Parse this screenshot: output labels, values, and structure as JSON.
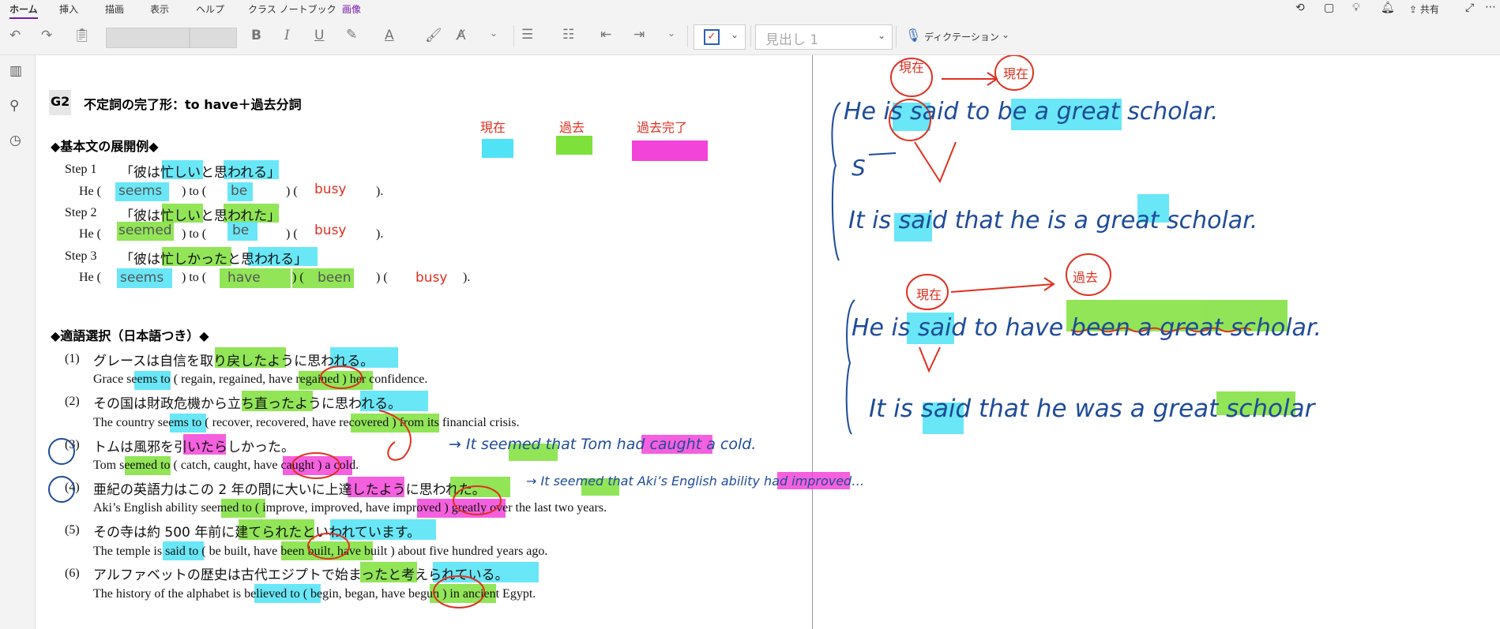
{
  "ribbon": {
    "tabs": [
      "ホーム",
      "挿入",
      "描画",
      "表示",
      "ヘルプ",
      "クラス ノートブック",
      "画像"
    ],
    "active_tab": "ホーム",
    "share_label": "共有",
    "heading_style": "見出し 1",
    "dictation_label": "ディクテーション"
  },
  "note": {
    "section_tag": "G2",
    "title": "不定詞の完了形：to have＋過去分詞",
    "legend": {
      "present": "現在",
      "past": "過去",
      "past_perfect": "過去完了"
    },
    "colors": {
      "present": "#4fe3f5",
      "past": "#7ee03a",
      "past_perfect": "#f244d8",
      "ink": "#1f4b99",
      "red_ink": "#e03020"
    },
    "section1_heading": "◆基本文の展開例◆",
    "step1_label": "Step 1",
    "step1_jp": "「彼は忙しいと思われる」",
    "step1_he": "He (",
    "step1_a": "seems",
    "step1_to": ") to (",
    "step1_b": "be",
    "step1_paren": ") (",
    "step1_c": "busy",
    "step1_end": ").",
    "step2_label": "Step 2",
    "step2_jp": "「彼は忙しいと思われた」",
    "step2_he": "He (",
    "step2_a": "seemed",
    "step2_to": ") to (",
    "step2_b": "be",
    "step2_paren": ") (",
    "step2_c": "busy",
    "step2_end": ").",
    "step3_label": "Step 3",
    "step3_jp": "「彼は忙しかったと思われる」",
    "step3_he": "He (",
    "step3_a": "seems",
    "step3_to": ") to (",
    "step3_b": "have",
    "step3_p1": ") (",
    "step3_c": "been",
    "step3_p2": ") (",
    "step3_d": "busy",
    "step3_end": ").",
    "section2_heading": "◆適語選択（日本語つき）◆",
    "q1_num": "(1)",
    "q1_jp": "グレースは自信を取り戻したように思われる。",
    "q1_en": "Grace seems to ( regain, regained, have regained ) her confidence.",
    "q2_num": "(2)",
    "q2_jp": "その国は財政危機から立ち直ったように思われる。",
    "q2_en": "The country seems to ( recover, recovered, have recovered ) from its financial crisis.",
    "q3_num": "(3)",
    "q3_jp": "トムは風邪を引いたらしかった。",
    "q3_en": "Tom seemed to ( catch, caught, have caught ) a cold.",
    "q4_num": "(4)",
    "q4_jp": "亜紀の英語力はこの 2 年の間に大いに上達したように思われた。",
    "q4_en": "Aki’s English ability seemed to ( improve, improved, have improved ) greatly over the last two years.",
    "q5_num": "(5)",
    "q5_jp": "その寺は約 500 年前に建てられたといわれています。",
    "q5_en": "The temple is said to ( be built, have been built, have built ) about five hundred years ago.",
    "q6_num": "(6)",
    "q6_jp": "アルファベットの歴史は古代エジプトで始まったと考えられている。",
    "q6_en": "The history of the alphabet is believed to ( begin, began, have begun ) in ancient Egypt."
  },
  "handwriting": {
    "note3": "→ It seemed that Tom had caught a cold.",
    "note4": "→ It seemed that Aki’s English ability had improved…",
    "genzai_1": "現在",
    "genzai_2": "現在",
    "genzai_3": "現在",
    "kako": "過去",
    "s1": "He is said to be a great scholar.",
    "s_label": "S",
    "s2": "It is said that he is a great scholar.",
    "s3": "He is said to have been a great scholar.",
    "s4": "It is said that he was a great scholar"
  }
}
